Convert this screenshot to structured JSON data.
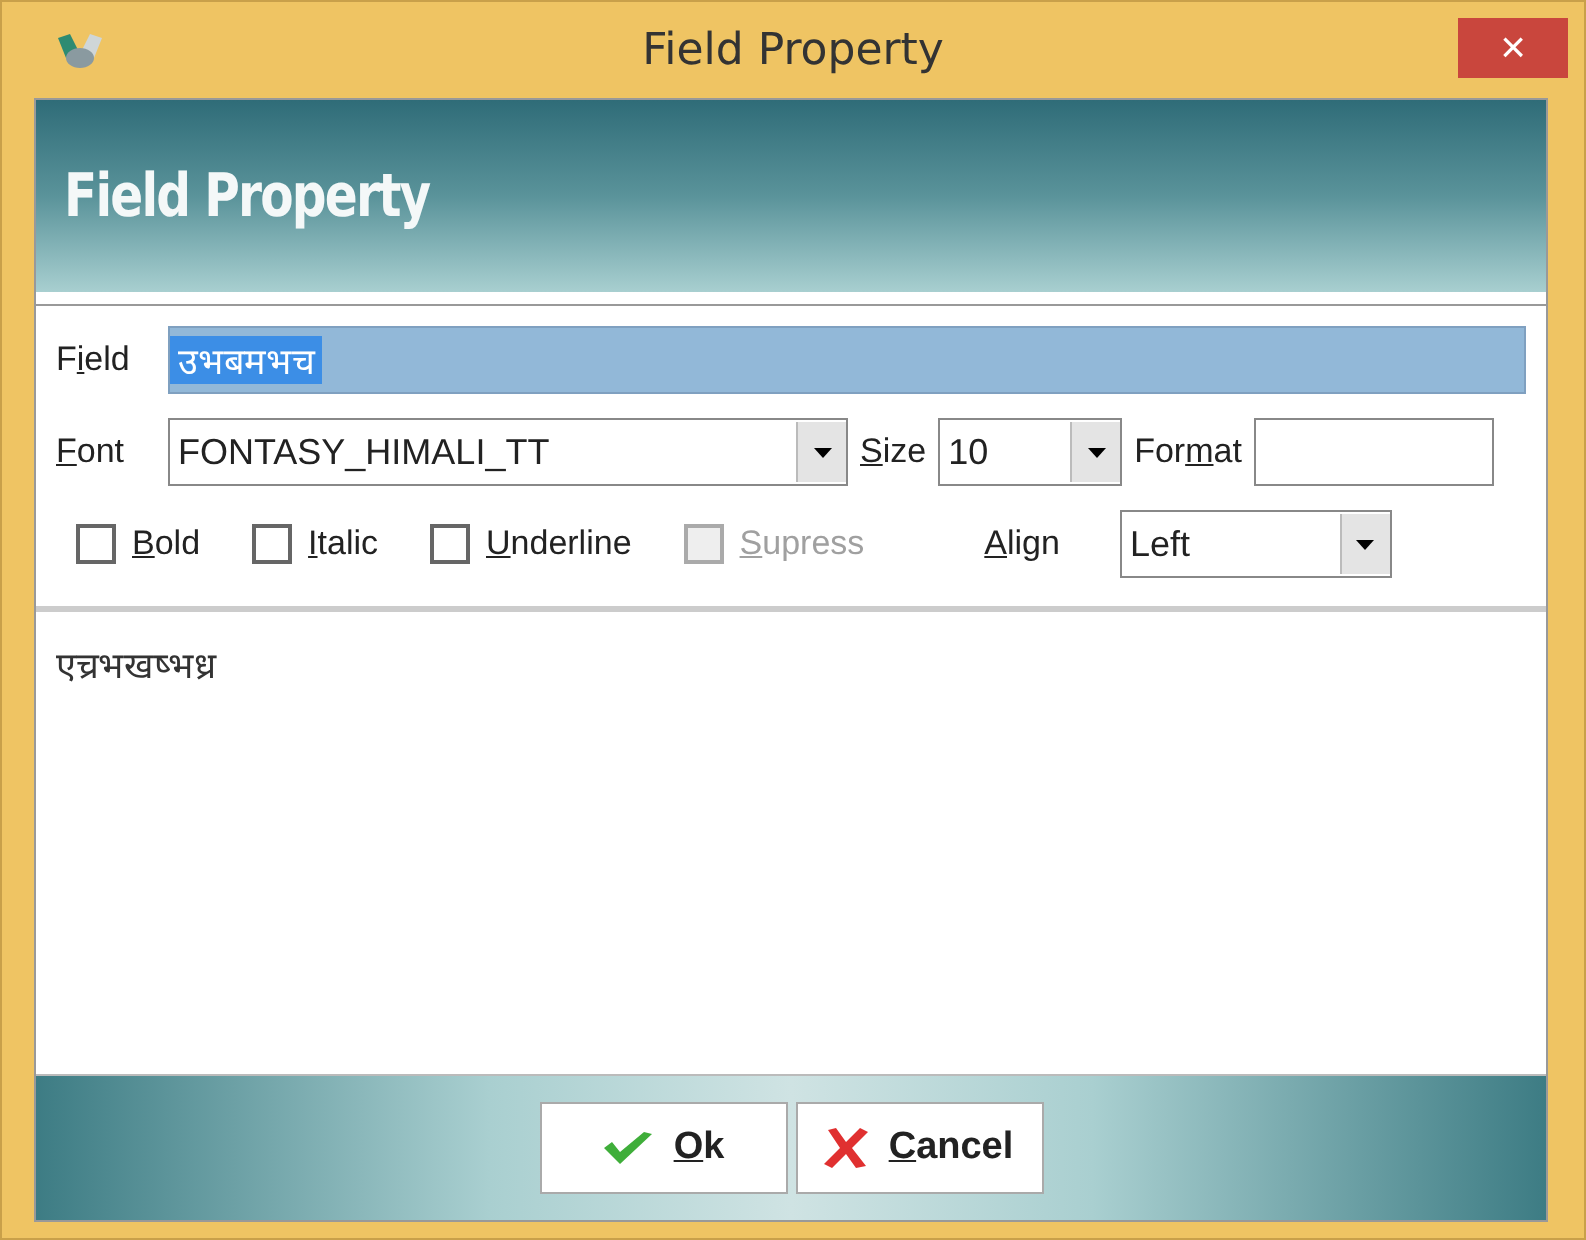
{
  "window": {
    "title": "Field Property",
    "close": "×"
  },
  "banner": {
    "title": "Field Property"
  },
  "field": {
    "label_parts": {
      "pre": "F",
      "key": "i",
      "rest": "eld"
    },
    "value": "उभबमभच",
    "selected": true
  },
  "font": {
    "label_parts": {
      "key": "F",
      "rest": "ont"
    },
    "value": "FONTASY_HIMALI_TT"
  },
  "size": {
    "label_parts": {
      "key": "S",
      "rest": "ize"
    },
    "value": "10"
  },
  "format": {
    "label_parts": {
      "pre": "For",
      "key": "m",
      "rest": "at"
    }
  },
  "options": [
    {
      "label_parts": {
        "key": "B",
        "rest": "old"
      },
      "checked": false,
      "disabled": false
    },
    {
      "label_parts": {
        "key": "I",
        "rest": "talic"
      },
      "checked": false,
      "disabled": false
    },
    {
      "label_parts": {
        "key": "U",
        "rest": "nderline"
      },
      "checked": false,
      "disabled": false
    },
    {
      "label_parts": {
        "key": "S",
        "rest": "upress"
      },
      "checked": false,
      "disabled": true
    }
  ],
  "align": {
    "label_parts": {
      "key": "A",
      "rest": "lign"
    },
    "value": "Left"
  },
  "preview": {
    "text": "एच्रभखष्भध्र"
  },
  "buttons": [
    {
      "kind": "ok",
      "label_parts": {
        "key": "O",
        "rest": "k"
      }
    },
    {
      "kind": "cancel",
      "label_parts": {
        "key": "C",
        "rest": "ancel"
      }
    }
  ]
}
